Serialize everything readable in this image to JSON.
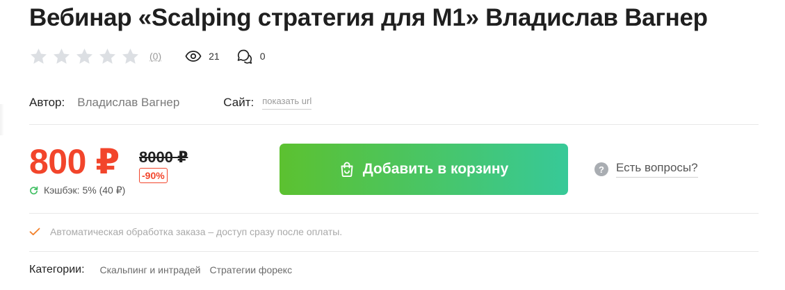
{
  "product": {
    "title": "Вебинар «Scalping стратегия для M1» Владислав Вагнер"
  },
  "rating": {
    "stars_filled": 0,
    "stars_total": 5,
    "count_label": "(0)",
    "star_color": "#dcdfe3"
  },
  "stats": {
    "views": "21",
    "comments": "0",
    "views_icon": "eye-icon",
    "comments_icon": "chat-bubbles-icon"
  },
  "meta": {
    "author_label": "Автор:",
    "author_value": "Владислав Вагнер",
    "site_label": "Сайт:",
    "site_link": "показать url"
  },
  "price": {
    "current": "800 ₽",
    "old": "8000 ₽",
    "discount": "-90%",
    "cashback": "Кэшбэк: 5% (40 ₽)",
    "accent_color": "#f2452b"
  },
  "cart": {
    "button_label": "Добавить в корзину",
    "icon": "shopping-bag-icon",
    "gradient_start": "#5cc130",
    "gradient_end": "#37c998"
  },
  "questions": {
    "icon_glyph": "?",
    "label": "Есть вопросы?"
  },
  "notice": {
    "text": "Автоматическая обработка заказа – доступ сразу после оплаты."
  },
  "categories": {
    "label": "Категории:",
    "items": [
      "Скальпинг и интрадей",
      "Стратегии форекс"
    ]
  }
}
